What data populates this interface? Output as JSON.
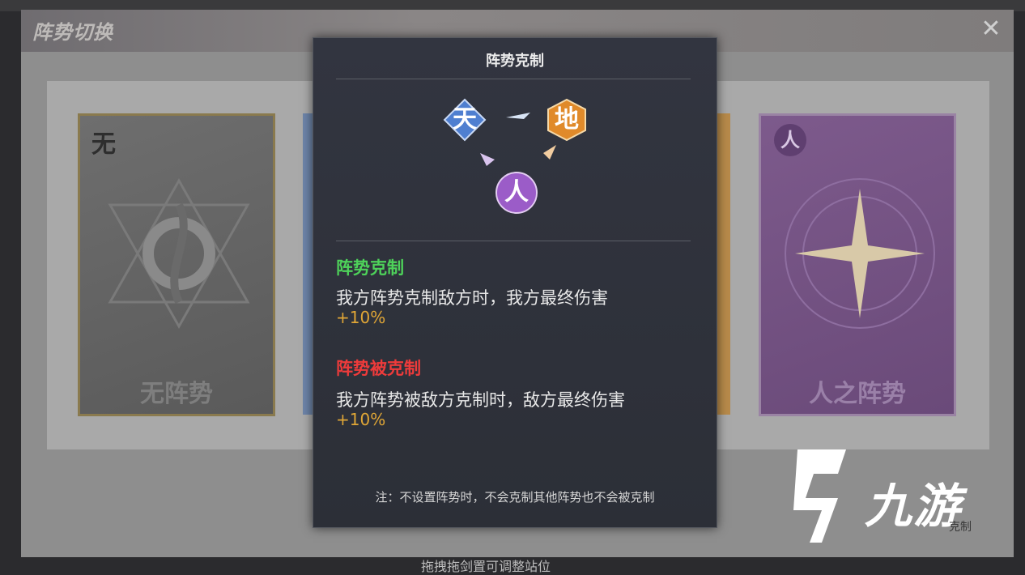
{
  "window": {
    "title": "阵势切换",
    "close_icon": "close-icon"
  },
  "cards": [
    {
      "corner": "无",
      "label": "无阵势"
    },
    {
      "corner": "人",
      "label": "人之阵势"
    }
  ],
  "dialog": {
    "title": "阵势克制",
    "diagram": {
      "heaven": "天",
      "earth": "地",
      "human": "人"
    },
    "counter": {
      "title": "阵势克制",
      "body": "我方阵势克制敌方时，我方最终伤害",
      "value": "+10%",
      "title_color": "#4ed25a"
    },
    "countered": {
      "title": "阵势被克制",
      "body": "我方阵势被敌方克制时，敌方最终伤害",
      "value": "+10%",
      "title_color": "#ee3b3b"
    },
    "note": "注：不设置阵势时，不会克制其他阵势也不会被克制"
  },
  "bottom_hint": "拖拽拖剑置可调整站位",
  "watermark": {
    "text": "九游",
    "button_label": "克制"
  },
  "colors": {
    "value_orange": "#e0a636",
    "heaven_blue": "#4f7fd0",
    "earth_orange": "#e08a2a",
    "human_purple": "#9b5cc8"
  }
}
